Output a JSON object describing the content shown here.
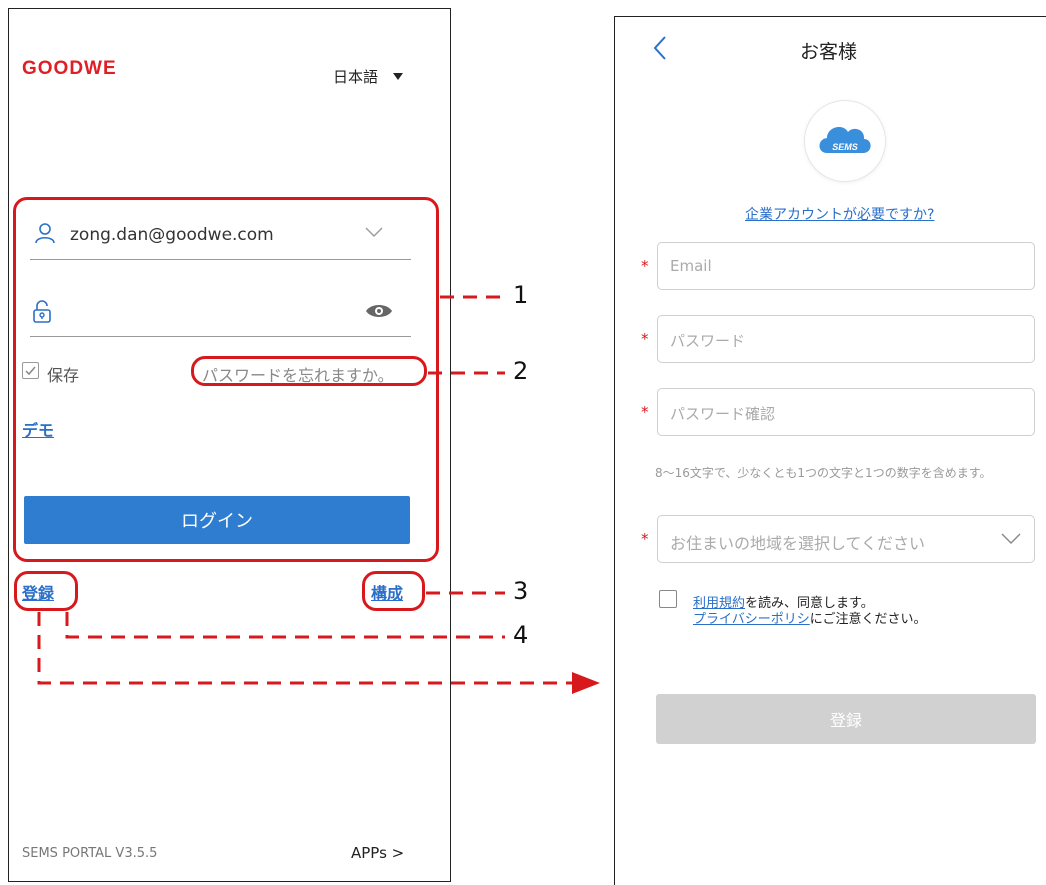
{
  "login_screen": {
    "logo_text": "GOODWE",
    "language": "日本語",
    "email_value": "zong.dan@goodwe.com",
    "save_label": "保存",
    "forgot_password": "パスワードを忘れますか。",
    "demo_link": "デモ",
    "login_button": "ログイン",
    "register_link": "登録",
    "config_link": "構成",
    "version": "SEMS PORTAL V3.5.5",
    "apps_link": "APPs >"
  },
  "annotations": {
    "labels": [
      "1",
      "2",
      "3",
      "4"
    ],
    "color": "#d7191d"
  },
  "register_screen": {
    "title": "お客様",
    "logo_text": "SEMS",
    "business_account_link": "企業アカウントが必要ですか?",
    "required_mark": "*",
    "email_placeholder": "Email",
    "password_placeholder": "パスワード",
    "confirm_password_placeholder": "パスワード確認",
    "password_hint": "8～16文字で、少なくとも1つの文字と1つの数字を含めます。",
    "region_placeholder": "お住まいの地域を選択してください",
    "terms_link": "利用規約",
    "terms_text": "を読み、同意します。",
    "privacy_link": "プライバシーポリシ",
    "privacy_text": "にご注意ください。",
    "register_button": "登録"
  },
  "colors": {
    "brand_red": "#e01e25",
    "link_blue": "#2a6fc9",
    "button_blue": "#2f7dd1",
    "disabled_gray": "#d1d1d1"
  }
}
